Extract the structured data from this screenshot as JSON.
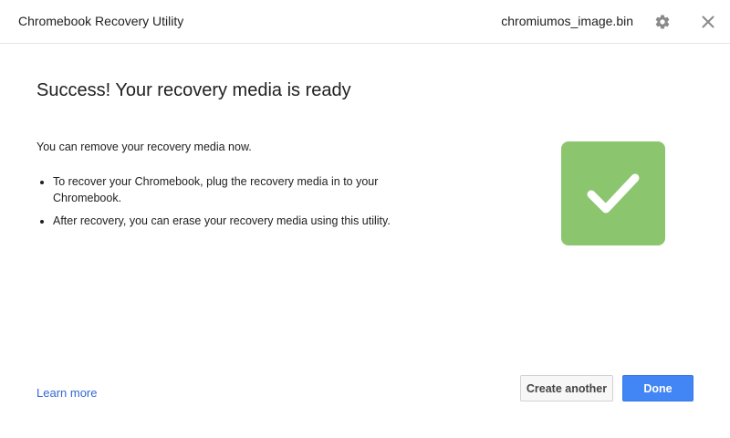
{
  "window": {
    "title": "Chromebook Recovery Utility",
    "file_name": "chromiumos_image.bin",
    "settings_icon": "gear-icon",
    "close_icon": "close-icon"
  },
  "main": {
    "headline": "Success! Your recovery media is ready",
    "lead": "You can remove your recovery media now.",
    "bullets": [
      "To recover your Chromebook, plug the recovery media in to your Chromebook.",
      "After recovery, you can erase your recovery media using this utility."
    ],
    "status_icon": "checkmark-icon"
  },
  "footer": {
    "learn_more": "Learn more",
    "create_another": "Create another",
    "done": "Done"
  },
  "colors": {
    "success_green": "#8bc56e",
    "primary_blue": "#4285f4",
    "link_blue": "#3367d6"
  }
}
